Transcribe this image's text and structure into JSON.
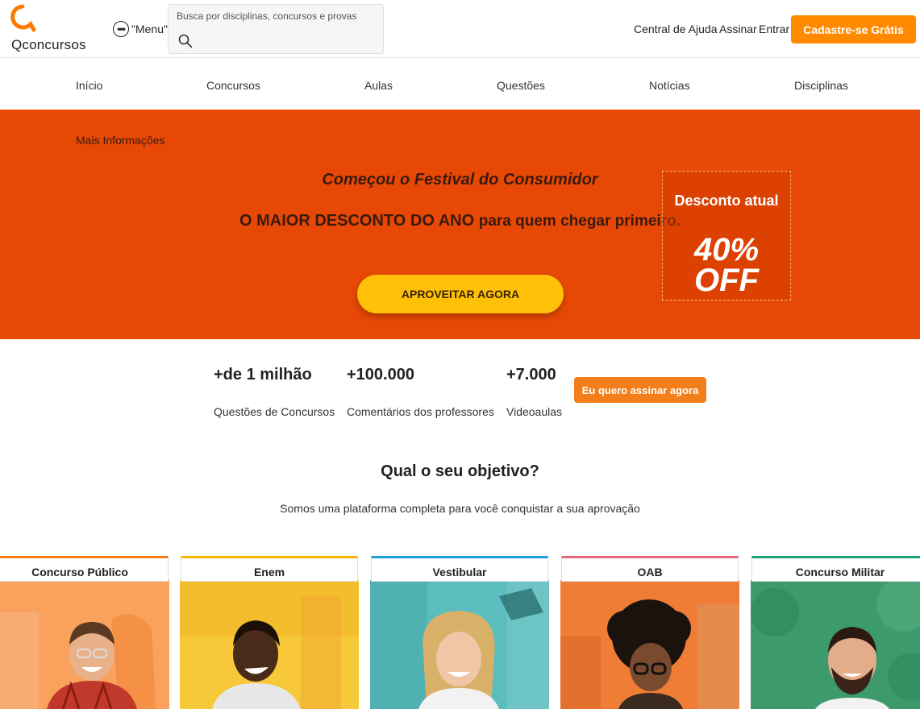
{
  "header": {
    "logo_text": "Qconcursos",
    "menu_label": "\"Menu\"",
    "search_placeholder": "Busca por disciplinas, concursos e provas",
    "links": [
      "Central de Ajuda",
      "Assinar",
      "Entrar"
    ],
    "cta_label": "Cadastre-se Grátis",
    "brand_color": "#ff8a00"
  },
  "nav": {
    "items": [
      "Início",
      "Concursos",
      "Aulas",
      "Questões",
      "Notícias",
      "Disciplinas"
    ]
  },
  "banner": {
    "more_info": "Mais Informações",
    "title": "Começou o Festival do Consumidor",
    "subtitle_strong": "O MAIOR DESCONTO DO ANO",
    "subtitle_rest": "para quem chegar primeiro.",
    "button_label": "APROVEITAR AGORA",
    "discount_label": "Desconto atual",
    "discount_value_1": "40%",
    "discount_value_2": "OFF",
    "bg_color": "#e84805",
    "button_color": "#ffc107"
  },
  "stats": {
    "items": [
      {
        "value": "+de 1 milhão",
        "label": "Questões de Concursos"
      },
      {
        "value": "+100.000",
        "label": "Comentários dos professores"
      },
      {
        "value": "+7.000",
        "label": "Videoaulas"
      }
    ],
    "button_label": "Eu quero assinar agora"
  },
  "objective": {
    "title": "Qual o seu objetivo?",
    "subtitle": "Somos uma plataforma completa para você conquistar a sua aprovação",
    "cards": [
      {
        "label": "Concurso Público",
        "accent": "#f47f1a",
        "bg": "#f9a15d"
      },
      {
        "label": "Enem",
        "accent": "#f5b800",
        "bg": "#f7c93a"
      },
      {
        "label": "Vestibular",
        "accent": "#1ba1dc",
        "bg": "#5bbdbd"
      },
      {
        "label": "OAB",
        "accent": "#e86a7a",
        "bg": "#ef7d35"
      },
      {
        "label": "Concurso Militar",
        "accent": "#1fa57a",
        "bg": "#3d9a6c"
      }
    ]
  }
}
